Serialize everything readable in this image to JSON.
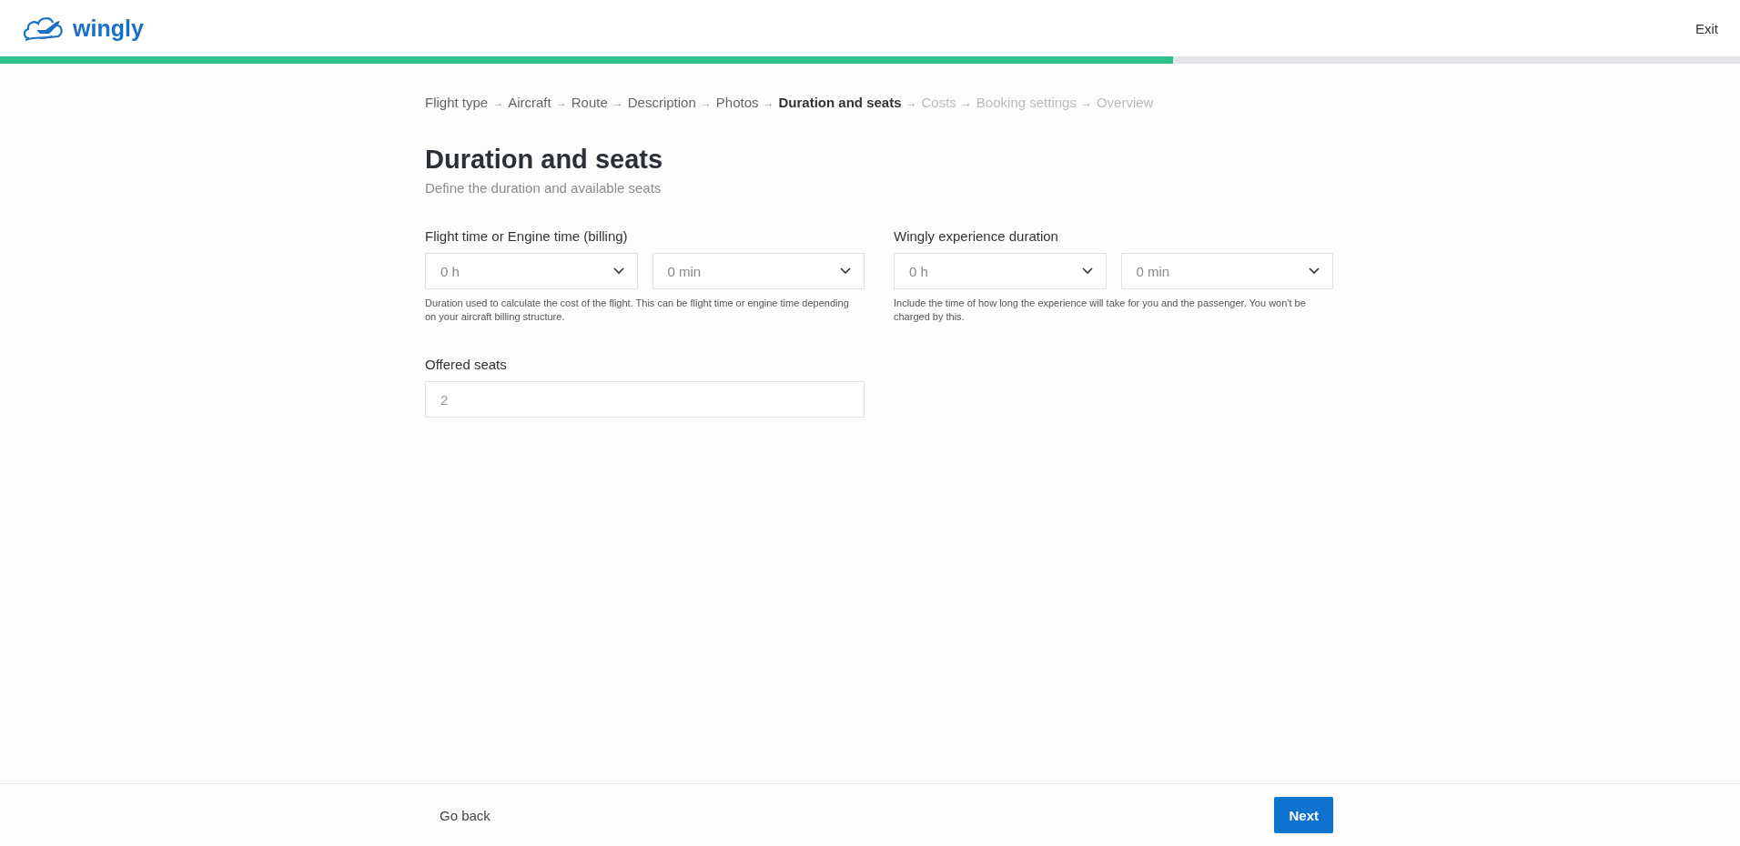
{
  "header": {
    "logo_text": "wingly",
    "exit_link": "Exit"
  },
  "progress": {
    "level": 0.674
  },
  "breadcrumb": [
    {
      "label": "Flight type",
      "completed": true,
      "selected": false
    },
    {
      "label": "Aircraft",
      "completed": true,
      "selected": false
    },
    {
      "label": "Route",
      "completed": true,
      "selected": false
    },
    {
      "label": "Description",
      "completed": true,
      "selected": false
    },
    {
      "label": "Photos",
      "completed": true,
      "selected": false
    },
    {
      "label": "Duration and seats",
      "completed": false,
      "selected": true
    },
    {
      "label": "Costs",
      "completed": false,
      "selected": false
    },
    {
      "label": "Booking settings",
      "completed": false,
      "selected": false
    },
    {
      "label": "Overview",
      "completed": false,
      "selected": false
    }
  ],
  "separator": "→",
  "title": "Duration and seats",
  "subtitle": "Define the duration and available seats",
  "duration_groups": [
    {
      "label": "Flight time or Engine time (billing)",
      "selects": [
        {
          "value": "0 h"
        },
        {
          "value": "0 min"
        }
      ],
      "help": "Duration used to calculate the cost of the flight. This can be flight time or engine time depending on your aircraft billing structure."
    },
    {
      "label": "Wingly experience duration",
      "selects": [
        {
          "value": "0 h"
        },
        {
          "value": "0 min"
        }
      ],
      "help": "Include the time of how long the experience will take for you and the passenger. You won't be charged by this."
    }
  ],
  "seats": {
    "label": "Offered seats",
    "placeholder": "2"
  },
  "footer": {
    "back": "Go back",
    "next": "Next"
  }
}
